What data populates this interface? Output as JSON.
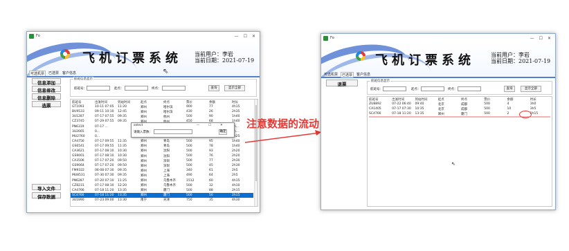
{
  "colors": {
    "accent": "#0b6fd1",
    "annotation": "#e53935",
    "banner_swoosh": "#5f86d6"
  },
  "left_window": {
    "title": "飞机订票系统",
    "user_label": "当前用户：李岩",
    "date_label": "当前日期：2021-07-19",
    "tabs": [
      "可选机票",
      "已选票",
      "客户信息"
    ],
    "buttons": {
      "add": "信息添加",
      "edit": "信息修改",
      "delete": "信息删除",
      "select": "选票",
      "import": "导入文件",
      "save": "保存数据"
    },
    "query": {
      "legend": "航班信息显示",
      "flight_label": "航班号：",
      "origin_label": "起点：",
      "dest_label": "终点：",
      "search_btn": "查询",
      "show_all_btn": "显示全部"
    },
    "columns": [
      "航班号",
      "出发时间",
      "到站时间",
      "起点",
      "终点",
      "票价",
      "余额",
      "时长"
    ],
    "rows": [
      [
        "GT1093",
        "10-11 07:05",
        "11:20",
        "郑州",
        "哈尔滨",
        "900",
        "77",
        "4h15"
      ],
      [
        "BU9533",
        "09-11 10:10",
        "12:45",
        "郑州",
        "哈尔滨",
        "430",
        "26",
        "2h35"
      ],
      [
        "3U1287",
        "07-17 07:55",
        "09:35",
        "郑州",
        "杭州",
        "500",
        "90",
        "1h40"
      ],
      [
        "CZ3745",
        "07-29 07:55",
        "09:35",
        "郑州",
        "杭州",
        "450",
        "68",
        "1h40"
      ],
      [
        "PN6319",
        "07-17 ...",
        "",
        "",
        "南宁",
        "554",
        "38",
        "2h..."
      ],
      [
        "3U2665",
        "0...",
        "",
        "",
        "南宁",
        "500",
        "69",
        "2h..."
      ],
      [
        "MU2760",
        "0...",
        "",
        "",
        "南京",
        "250",
        "42",
        "1h25"
      ],
      [
        "CA4756",
        "07-17 09:55",
        "11:35",
        "郑州",
        "青岛",
        "500",
        "95",
        "1h40"
      ],
      [
        "GS6541",
        "07-17 09:55",
        "11:35",
        "郑州",
        "青岛",
        "500",
        "78",
        "1h40"
      ],
      [
        "CA3621",
        "07-17 08:10",
        "10:30",
        "郑州",
        "沈阳",
        "500",
        "93",
        "2h20"
      ],
      [
        "GS9001",
        "07-17 08:10",
        "10:30",
        "郑州",
        "沈阳",
        "500",
        "76",
        "2h20"
      ],
      [
        "CA3506",
        "07-17 07:20",
        "09:50",
        "郑州",
        "深圳",
        "500",
        "77",
        "2h30"
      ],
      [
        "GS9064",
        "07-17 07:20",
        "09:50",
        "郑州",
        "深圳",
        "500",
        "45",
        "2h30"
      ],
      [
        "FM9322",
        "06-08 07:30",
        "09:35",
        "郑州",
        "上海",
        "340",
        "61",
        "2h5"
      ],
      [
        "MU8531",
        "07-30 07:30",
        "09:35",
        "郑州",
        "上海",
        "490",
        "64",
        "2h5"
      ],
      [
        "PN6287",
        "07-20 07:10",
        "11:25",
        "郑州",
        "乌鲁木齐",
        "1512",
        "60",
        "4h15"
      ],
      [
        "CZ8231",
        "07-17 08:10",
        "12:20",
        "郑州",
        "乌鲁木齐",
        "500",
        "32",
        "4h10"
      ],
      [
        "CA4766",
        "07-18 11:20",
        "13:35",
        "郑州",
        "厦门",
        "500",
        "88",
        "2h15"
      ],
      [
        "SC4766",
        "07-18 11:20",
        "13:35",
        "郑州",
        "厦门",
        "500",
        "50",
        "2h15"
      ],
      [
        "3U1890",
        "07-23 09:00",
        "13:30",
        "南宁",
        "天津",
        "750",
        "35",
        "4h30"
      ]
    ],
    "selected_row": 18,
    "popup": {
      "title": "select",
      "min": "—",
      "max": "☐",
      "close": "✕",
      "label": "请输入票数：",
      "ok": "确定"
    }
  },
  "annotation": "注意数据的流动",
  "right_window": {
    "title": "飞机订票系统",
    "user_label": "当前用户：李岩",
    "date_label": "当前日期：2021-07-19",
    "tabs": [
      "可选机票",
      "已选票",
      "客户信息"
    ],
    "buttons": {
      "refund": "退票"
    },
    "query": {
      "legend": "航班信息显示",
      "flight_label": "航班号：",
      "origin_label": "起点：",
      "dest_label": "终点：",
      "search_btn": "查询",
      "show_all_btn": "显示全部"
    },
    "columns": [
      "航班号",
      "出发时间",
      "到站时间",
      "起点",
      "终点",
      "票价",
      "余额",
      "时长"
    ],
    "rows": [
      [
        "ZU8892",
        "07-22 06:40",
        "09:40",
        "北京",
        "成都",
        "500",
        "4",
        "3h0"
      ],
      [
        "CA1405",
        "07-17 07:30",
        "10:35",
        "北京",
        "成都",
        "500",
        "10",
        "3h5"
      ],
      [
        "SC4766",
        "07-18 11:20",
        "13:35",
        "郑州",
        "厦门",
        "500",
        "2",
        "2h15"
      ]
    ]
  }
}
